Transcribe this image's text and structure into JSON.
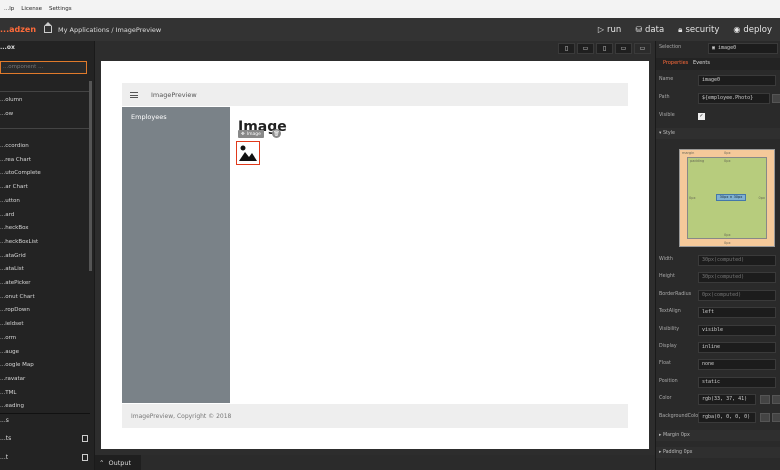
{
  "menubar": {
    "items": [
      "...lp",
      "License",
      "Settings"
    ]
  },
  "titlebar": {
    "brand": "...adzen",
    "breadcrumb": "My Applications / ImagePreview",
    "actions": [
      {
        "icon": "play-icon",
        "label": "run"
      },
      {
        "icon": "database-icon",
        "label": "data"
      },
      {
        "icon": "lock-icon",
        "label": "security"
      },
      {
        "icon": "eye-icon",
        "label": "deploy"
      }
    ]
  },
  "toolbox": {
    "title": "...ox",
    "search_placeholder": "...omponent ...",
    "layout_items": [
      "...olumn",
      "...ow"
    ],
    "items": [
      "...ccordion",
      "...rea Chart",
      "...utoComplete",
      "...ar Chart",
      "...utton",
      "...ard",
      "...heckBox",
      "...heckBoxList",
      "...ataGrid",
      "...ataList",
      "...atePicker",
      "...onut Chart",
      "...ropDown",
      "...ieldset",
      "...orm",
      "...auge",
      "...oogle Map",
      "...ravatar",
      "...TML",
      "...eading"
    ],
    "bottom": [
      "...s",
      "...ts",
      "...t"
    ]
  },
  "output_tab": {
    "icon": "chevron-up-icon",
    "label": "Output"
  },
  "device_buttons": [
    "phone-icon",
    "phone-landscape-icon",
    "tablet-icon",
    "laptop-icon",
    "desktop-icon"
  ],
  "app": {
    "header_title": "ImagePreview",
    "nav_item": "Employees",
    "heading": "Image",
    "selection_chip": "Image",
    "footer": "ImagePreview, Copyright © 2018"
  },
  "properties": {
    "selection_label": "Selection",
    "selection_value": "image0",
    "tabs": [
      "Properties",
      "Events"
    ],
    "name_label": "Name",
    "name_value": "image0",
    "path_label": "Path",
    "path_value": "${employee.Photo}",
    "visible_label": "Visible",
    "visible_checked": true,
    "style_label": "Style",
    "box_model": {
      "margin": "margin",
      "margin_val": "0px",
      "padding": "padding",
      "padding_val": "0px",
      "content": "30px × 30px",
      "side_val": "0px"
    },
    "fields": [
      {
        "label": "Width",
        "value": "30px(computed)"
      },
      {
        "label": "Height",
        "value": "30px(computed)"
      },
      {
        "label": "BorderRadius",
        "value": "0px(computed)"
      },
      {
        "label": "TextAlign",
        "value": "left"
      },
      {
        "label": "Visibility",
        "value": "visible"
      },
      {
        "label": "Display",
        "value": "inline"
      },
      {
        "label": "Float",
        "value": "none"
      },
      {
        "label": "Position",
        "value": "static"
      },
      {
        "label": "Color",
        "value": "rgb(33, 37, 41)"
      },
      {
        "label": "BackgroundColor",
        "value": "rgba(0, 0, 0, 0)"
      }
    ],
    "margin_section": "Margin 0px",
    "padding_section": "Padding 0px"
  }
}
